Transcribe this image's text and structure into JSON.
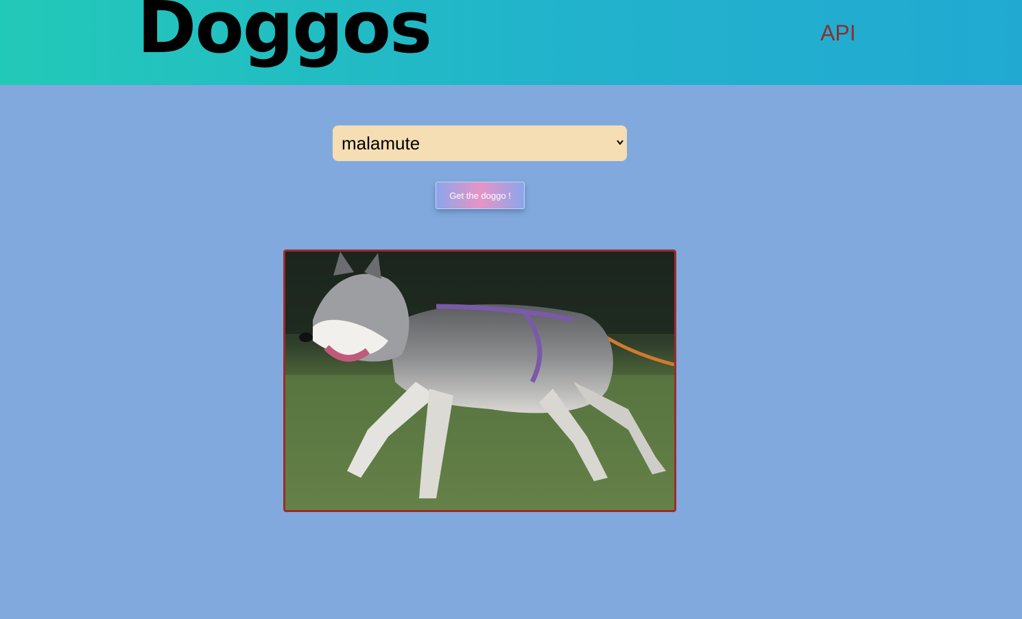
{
  "header": {
    "logo": "Doggos",
    "api_link": "API"
  },
  "breed_select": {
    "selected": "malamute"
  },
  "get_button": {
    "label": "Get the doggo !"
  },
  "photo": {
    "subject": "malamute dog running in harness"
  },
  "colors": {
    "page_background": "#81a9dd",
    "header_gradient_start": "#23c9b8",
    "header_gradient_end": "#21a9d2",
    "api_link": "#8b2f2f",
    "select_background": "#f5deb3",
    "photo_border": "#9e2a2b"
  }
}
